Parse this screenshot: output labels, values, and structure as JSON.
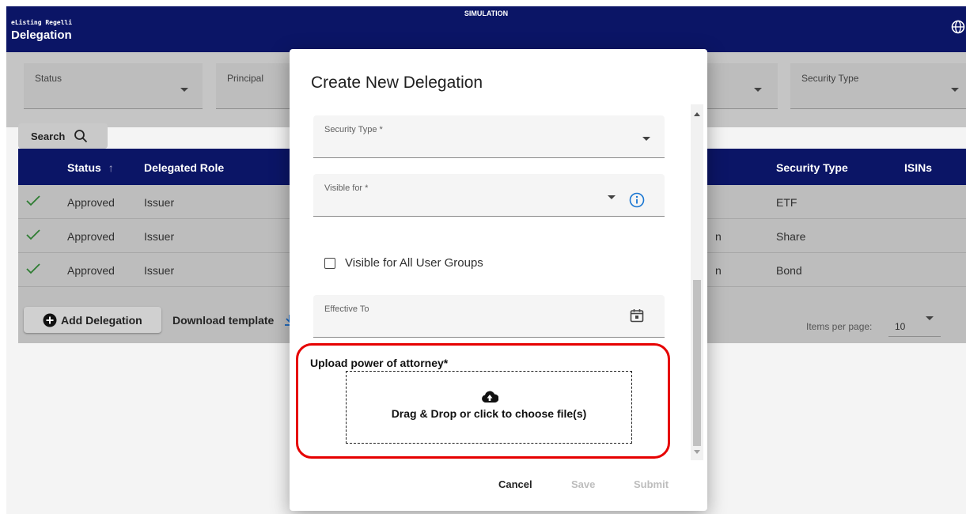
{
  "app": {
    "brand": "eListing Regelli",
    "page_title": "Delegation",
    "environment_label": "SIMULATION"
  },
  "filters": [
    {
      "label": "Status"
    },
    {
      "label": "Principal"
    },
    {
      "label": "Security Type"
    }
  ],
  "search": {
    "label": "Search"
  },
  "table": {
    "columns": [
      "Status",
      "Delegated Role",
      "Security Type",
      "ISINs"
    ],
    "sort_indicator": "↑",
    "rows": [
      {
        "status": "Approved",
        "role": "Issuer",
        "security_type": "ETF"
      },
      {
        "status": "Approved",
        "role": "Issuer",
        "security_type": "Share"
      },
      {
        "status": "Approved",
        "role": "Issuer",
        "security_type": "Bond"
      }
    ],
    "partial_chars": [
      "n",
      "n"
    ]
  },
  "actions": {
    "add_delegation": "Add Delegation",
    "download_template": "Download template"
  },
  "pagination": {
    "items_per_page_label": "Items per page:",
    "items_per_page_value": "10"
  },
  "modal": {
    "title": "Create New Delegation",
    "fields": {
      "security_type": "Security Type *",
      "visible_for": "Visible for *",
      "effective_to": "Effective To"
    },
    "visible_all_label": "Visible for All User Groups",
    "visible_all_checked": false,
    "upload_label": "Upload power of attorney*",
    "drop_text": "Drag & Drop or click to choose file(s)",
    "buttons": {
      "cancel": "Cancel",
      "save": "Save",
      "submit": "Submit"
    }
  },
  "colors": {
    "primary": "#0b1566",
    "highlight": "#e60000",
    "check": "#2e7d32",
    "info": "#1976d2",
    "disabled": "#bdbdbd"
  }
}
